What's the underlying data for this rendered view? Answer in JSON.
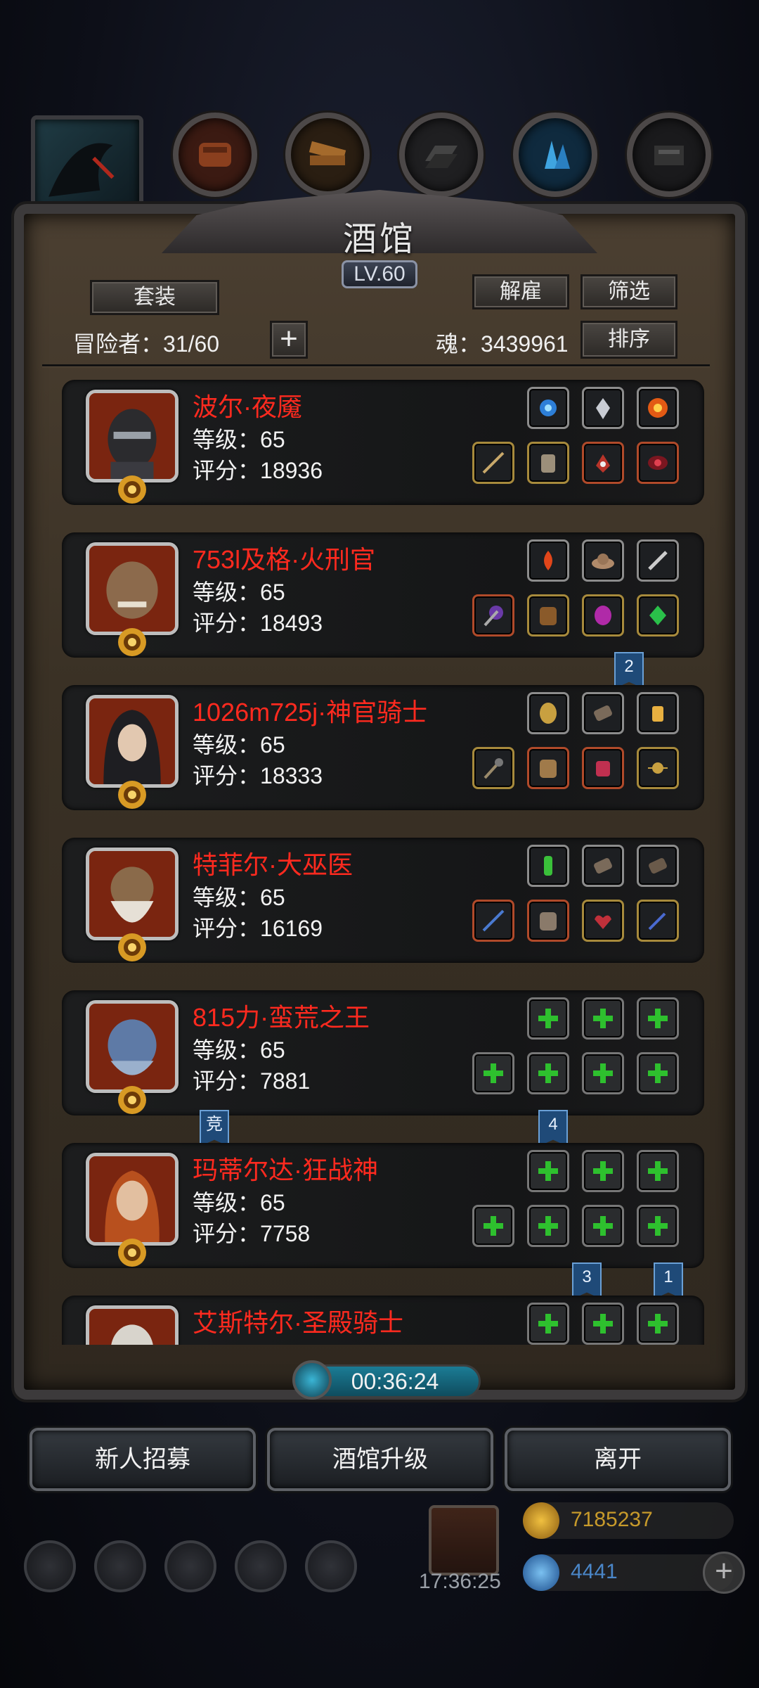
{
  "panel": {
    "title": "酒馆",
    "level": "LV.60",
    "suit_button": "套装",
    "dismiss_button": "解雇",
    "filter_button": "筛选",
    "sort_button": "排序",
    "adventurers_label": "冒险者：",
    "adventurers_count": "31/60",
    "soul_label": "魂：",
    "soul_value": "3439961"
  },
  "stat_labels": {
    "level": "等级：",
    "score": "评分："
  },
  "heroes": [
    {
      "name": "波尔·夜魇",
      "level": "65",
      "score": "18936"
    },
    {
      "name": "753l及格·火刑官",
      "level": "65",
      "score": "18493"
    },
    {
      "name": "1026m725j·神官骑士",
      "level": "65",
      "score": "18333"
    },
    {
      "name": "特菲尔·大巫医",
      "level": "65",
      "score": "16169"
    },
    {
      "name": "815力·蛮荒之王",
      "level": "65",
      "score": "7881"
    },
    {
      "name": "玛蒂尔达·狂战神",
      "level": "65",
      "score": "7758"
    },
    {
      "name": "艾斯特尔·圣殿骑士",
      "level": "",
      "score": ""
    }
  ],
  "flags": {
    "f_a": "2",
    "f_b": "竞",
    "f_c": "4",
    "f_d": "3",
    "f_e": "1"
  },
  "timer": "00:36:24",
  "bottom_buttons": {
    "recruit": "新人招募",
    "upgrade": "酒馆升级",
    "leave": "离开"
  },
  "hud": {
    "clock": "17:36:25",
    "gold": "7185237",
    "gems": "4441"
  },
  "colors": {
    "hero_name": "#ff2a1f",
    "timer_bar": "#1b7c95",
    "gold_text": "#c79a2b",
    "gem_text": "#4a86c8"
  }
}
